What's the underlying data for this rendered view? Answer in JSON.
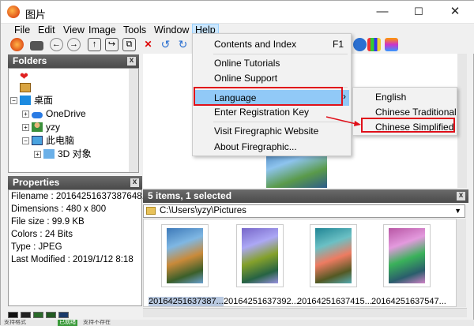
{
  "window": {
    "title": "图片",
    "min_glyph": "—",
    "max_glyph": "☐",
    "close_glyph": "✕"
  },
  "menubar": [
    "File",
    "Edit",
    "View",
    "Image",
    "Tools",
    "Window",
    "Help"
  ],
  "panes": {
    "folders": "Folders",
    "properties": "Properties",
    "files": "5 items, 1 selected"
  },
  "tree": [
    {
      "label": "桌面",
      "icon": "desktop-icon"
    },
    {
      "label": "OneDrive",
      "icon": "cloud-icon"
    },
    {
      "label": "yzy",
      "icon": "user-icon"
    },
    {
      "label": "此电脑",
      "icon": "computer-icon"
    },
    {
      "label": "3D 对象",
      "icon": "3d-objects-icon"
    }
  ],
  "properties": [
    "Filename : 20164251637387648...",
    "Dimensions : 480 x 800",
    "File size : 99.9 KB",
    "Colors : 24 Bits",
    "Type : JPEG",
    "Last Modified : 2019/1/12 8:18"
  ],
  "path": "C:\\Users\\yzy\\Pictures",
  "thumbnails": [
    {
      "caption": "20164251637387...",
      "selected": true
    },
    {
      "caption": "20164251637392...",
      "selected": false
    },
    {
      "caption": "20164251637415...",
      "selected": false
    },
    {
      "caption": "20164251637547...",
      "selected": false
    }
  ],
  "help_menu": {
    "contents": "Contents and Index",
    "contents_key": "F1",
    "tutorials": "Online Tutorials",
    "support": "Online Support",
    "language": "Language",
    "register": "Enter Registration Key",
    "website": "Visit Firegraphic Website",
    "about": "About Firegraphic..."
  },
  "language_menu": [
    "English",
    "Chinese Traditional",
    "Chinese Simplified"
  ],
  "status_text": [
    "支持格式",
    "已就绪",
    "支持不存在"
  ],
  "colors": {
    "highlight": "#91c9f7",
    "annotation_red": "#e0101a"
  }
}
